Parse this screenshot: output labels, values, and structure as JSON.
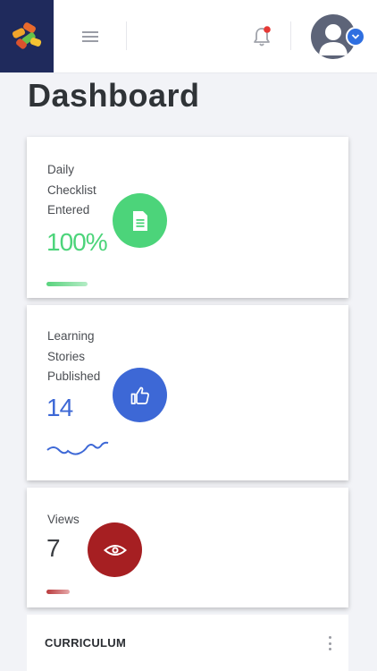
{
  "header": {
    "logo_icon": "app-logo",
    "menu_icon": "hamburger-menu-icon",
    "notification_icon": "bell-icon",
    "notification_dot_color": "#e53935",
    "avatar_icon": "user-avatar",
    "avatar_dropdown_icon": "chevron-down-icon"
  },
  "page": {
    "title": "Dashboard"
  },
  "cards": [
    {
      "label_lines": [
        "Daily",
        "Checklist",
        "Entered"
      ],
      "value": "100%",
      "icon": "document-icon",
      "color": "#4cd47a",
      "progress": 1.0
    },
    {
      "label_lines": [
        "Learning",
        "Stories",
        "Published"
      ],
      "value": "14",
      "icon": "thumbs-up-icon",
      "color": "#3d68d6",
      "sparkline_icon": "trend-sparkline"
    },
    {
      "label_lines": [
        "Views"
      ],
      "value": "7",
      "icon": "eye-icon",
      "color": "#a61f22",
      "progress": 0.3
    }
  ],
  "curriculum": {
    "title": "CURRICULUM",
    "menu_icon": "more-vertical-icon"
  }
}
